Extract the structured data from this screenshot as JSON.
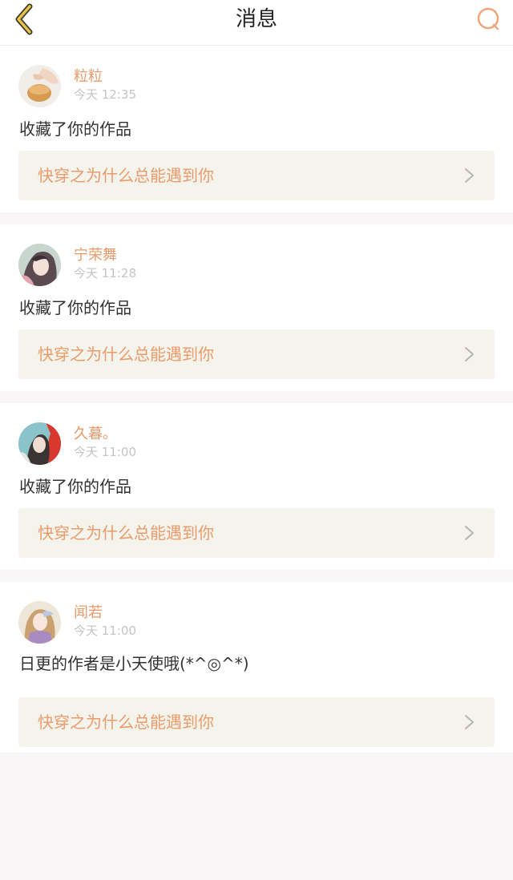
{
  "header": {
    "title": "消息"
  },
  "colors": {
    "accent": "#e99a6a",
    "back_arrow": "#e8c24a",
    "card_link_bg": "#f4f3ec"
  },
  "icons": {
    "back": "chevron-left-icon",
    "search": "search-icon",
    "link": "chevron-right-icon"
  },
  "messages": [
    {
      "username": "粒粒",
      "time": "今天 12:35",
      "text": "收藏了你的作品",
      "work_title": "快穿之为什么总能遇到你"
    },
    {
      "username": "宁荣舞",
      "time": "今天 11:28",
      "text": "收藏了你的作品",
      "work_title": "快穿之为什么总能遇到你"
    },
    {
      "username": "久暮。",
      "time": "今天 11:00",
      "text": "收藏了你的作品",
      "work_title": "快穿之为什么总能遇到你"
    },
    {
      "username": "闻若",
      "time": "今天 11:00",
      "text": "日更的作者是小天使哦(*^◎^*)",
      "work_title": "快穿之为什么总能遇到你"
    }
  ]
}
